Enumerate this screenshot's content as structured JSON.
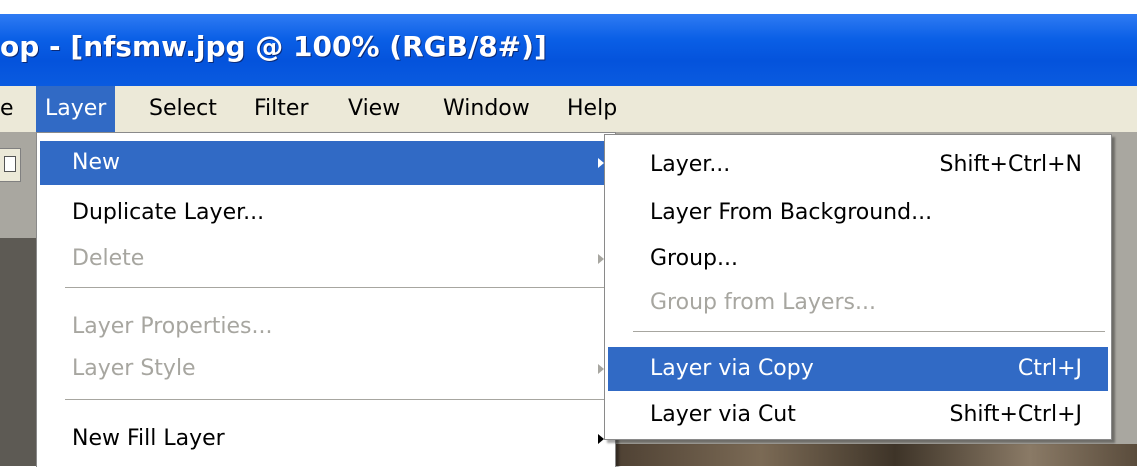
{
  "window": {
    "title": "op - [nfsmw.jpg @ 100% (RGB/8#)]"
  },
  "menubar": {
    "items": [
      {
        "label": "e"
      },
      {
        "label": "Layer"
      },
      {
        "label": "Select"
      },
      {
        "label": "Filter"
      },
      {
        "label": "View"
      },
      {
        "label": "Window"
      },
      {
        "label": "Help"
      }
    ]
  },
  "layer_menu": {
    "items": [
      {
        "label": "New",
        "state": "highlighted",
        "submenu": true
      },
      {
        "label": "Duplicate Layer...",
        "state": "enabled"
      },
      {
        "label": "Delete",
        "state": "disabled",
        "submenu": true
      },
      {
        "label": "Layer Properties...",
        "state": "disabled"
      },
      {
        "label": "Layer Style",
        "state": "disabled",
        "submenu": true
      },
      {
        "label": "New Fill Layer",
        "state": "enabled",
        "submenu": true
      }
    ]
  },
  "new_submenu": {
    "items": [
      {
        "label": "Layer...",
        "shortcut": "Shift+Ctrl+N",
        "state": "enabled"
      },
      {
        "label": "Layer From Background...",
        "shortcut": "",
        "state": "enabled"
      },
      {
        "label": "Group...",
        "shortcut": "",
        "state": "enabled"
      },
      {
        "label": "Group from Layers...",
        "shortcut": "",
        "state": "disabled"
      },
      {
        "label": "Layer via Copy",
        "shortcut": "Ctrl+J",
        "state": "highlighted"
      },
      {
        "label": "Layer via Cut",
        "shortcut": "Shift+Ctrl+J",
        "state": "enabled"
      }
    ]
  },
  "colors": {
    "titlebar": "#0453dc",
    "menu_highlight": "#316ac5",
    "menubar_bg": "#ece9d8",
    "disabled_text": "#a7a6a0"
  }
}
